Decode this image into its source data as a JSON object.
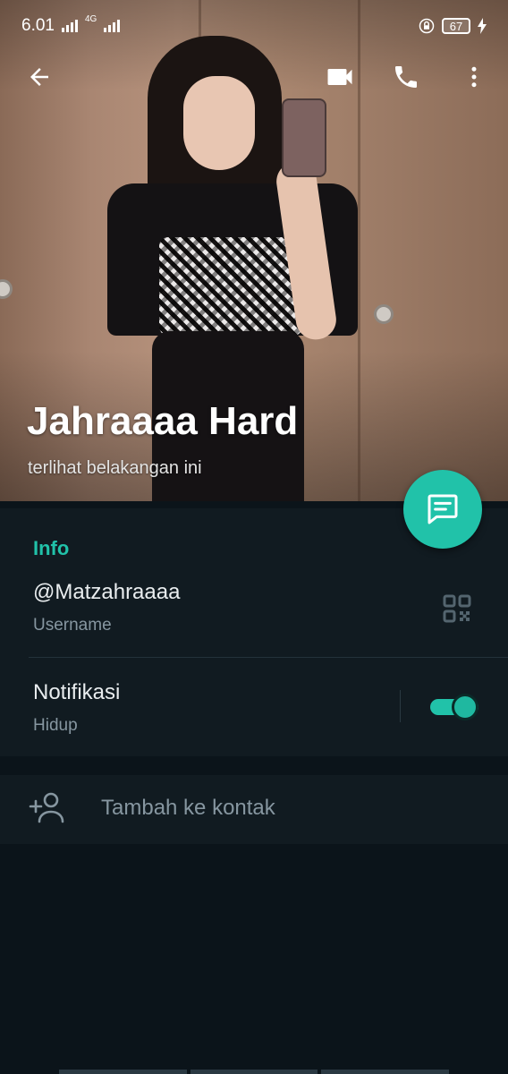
{
  "status_bar": {
    "time": "6.01",
    "network": "4G",
    "battery": "67"
  },
  "header": {
    "back_icon": "arrow-left-icon",
    "video_icon": "videocam-icon",
    "call_icon": "phone-icon",
    "menu_icon": "more-vert-icon"
  },
  "profile": {
    "name": "Jahraaaa Hard",
    "last_seen": "terlihat belakangan ini"
  },
  "fab": {
    "icon": "message-icon"
  },
  "info": {
    "section_title": "Info",
    "username_value": "@Matzahraaaa",
    "username_label": "Username",
    "notifications_label": "Notifikasi",
    "notifications_value": "Hidup",
    "notifications_enabled": true
  },
  "actions": {
    "add_contact_label": "Tambah ke kontak",
    "add_contact_icon": "person-add-icon"
  },
  "colors": {
    "accent": "#21c2a9",
    "background": "#0b141a",
    "card": "#111b21",
    "secondary_text": "#8696a0"
  }
}
